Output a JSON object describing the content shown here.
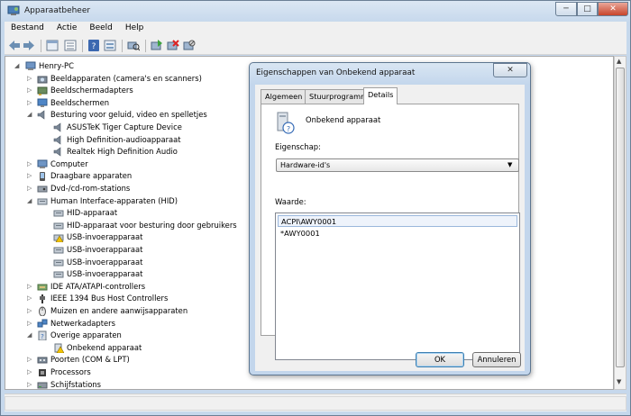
{
  "window": {
    "title": "Apparaatbeheer",
    "min_glyph": "─",
    "max_glyph": "□",
    "close_glyph": "✕"
  },
  "menu": [
    "Bestand",
    "Actie",
    "Beeld",
    "Help"
  ],
  "toolbar": {
    "icons": [
      "back-icon",
      "forward-icon",
      "properties-view-icon",
      "list-view-icon",
      "help-icon",
      "show-hidden-icon",
      "scan-hardware-icon",
      "update-driver-icon",
      "uninstall-icon",
      "disable-icon"
    ]
  },
  "tree": {
    "root": "Henry-PC",
    "rows": [
      {
        "label": "Beeldapparaten (camera's en scanners)",
        "level": 1,
        "expander": "▷",
        "icon": "camera-icon"
      },
      {
        "label": "Beeldschermadapters",
        "level": 1,
        "expander": "▷",
        "icon": "display-adapter-icon"
      },
      {
        "label": "Beeldschermen",
        "level": 1,
        "expander": "▷",
        "icon": "monitor-icon"
      },
      {
        "label": "Besturing voor geluid, video en spelletjes",
        "level": 1,
        "expander": "◢",
        "icon": "speaker-icon"
      },
      {
        "label": "ASUSTeK Tiger Capture Device",
        "level": 2,
        "expander": "",
        "icon": "speaker-icon"
      },
      {
        "label": "High Definition-audioapparaat",
        "level": 2,
        "expander": "",
        "icon": "speaker-icon"
      },
      {
        "label": "Realtek High Definition Audio",
        "level": 2,
        "expander": "",
        "icon": "speaker-icon"
      },
      {
        "label": "Computer",
        "level": 1,
        "expander": "▷",
        "icon": "computer-icon"
      },
      {
        "label": "Draagbare apparaten",
        "level": 1,
        "expander": "▷",
        "icon": "portable-device-icon"
      },
      {
        "label": "Dvd-/cd-rom-stations",
        "level": 1,
        "expander": "▷",
        "icon": "dvd-drive-icon"
      },
      {
        "label": "Human Interface-apparaten (HID)",
        "level": 1,
        "expander": "◢",
        "icon": "hid-icon"
      },
      {
        "label": "HID-apparaat",
        "level": 2,
        "expander": "",
        "icon": "hid-icon"
      },
      {
        "label": "HID-apparaat voor besturing door gebruikers",
        "level": 2,
        "expander": "",
        "icon": "hid-icon"
      },
      {
        "label": "USB-invoerapparaat",
        "level": 2,
        "expander": "",
        "icon": "hid-warning-icon"
      },
      {
        "label": "USB-invoerapparaat",
        "level": 2,
        "expander": "",
        "icon": "hid-icon"
      },
      {
        "label": "USB-invoerapparaat",
        "level": 2,
        "expander": "",
        "icon": "hid-icon"
      },
      {
        "label": "USB-invoerapparaat",
        "level": 2,
        "expander": "",
        "icon": "hid-icon"
      },
      {
        "label": "IDE ATA/ATAPI-controllers",
        "level": 1,
        "expander": "▷",
        "icon": "ide-controller-icon"
      },
      {
        "label": "IEEE 1394 Bus Host Controllers",
        "level": 1,
        "expander": "▷",
        "icon": "firewire-icon"
      },
      {
        "label": "Muizen en andere aanwijsapparaten",
        "level": 1,
        "expander": "▷",
        "icon": "mouse-icon"
      },
      {
        "label": "Netwerkadapters",
        "level": 1,
        "expander": "▷",
        "icon": "network-adapter-icon"
      },
      {
        "label": "Overige apparaten",
        "level": 1,
        "expander": "◢",
        "icon": "other-devices-icon"
      },
      {
        "label": "Onbekend apparaat",
        "level": 2,
        "expander": "",
        "icon": "unknown-device-warning-icon"
      },
      {
        "label": "Poorten (COM & LPT)",
        "level": 1,
        "expander": "▷",
        "icon": "port-icon"
      },
      {
        "label": "Processors",
        "level": 1,
        "expander": "▷",
        "icon": "processor-icon"
      },
      {
        "label": "Schijfstations",
        "level": 1,
        "expander": "▷",
        "icon": "disk-drive-icon"
      }
    ]
  },
  "dialog": {
    "title": "Eigenschappen van Onbekend apparaat",
    "close_glyph": "✕",
    "tabs": [
      "Algemeen",
      "Stuurprogramma",
      "Details"
    ],
    "active_tab": "Details",
    "device_name": "Onbekend apparaat",
    "property_label": "Eigenschap:",
    "property_value": "Hardware-id's",
    "value_label": "Waarde:",
    "values": [
      "ACPI\\AWY0001",
      "*AWY0001"
    ],
    "ok": "OK",
    "cancel": "Annuleren"
  },
  "colors": {
    "titlebar": "#c6d8ec",
    "close_button": "#c8442b",
    "selection": "#eef3fb",
    "warning": "#f2c400"
  }
}
